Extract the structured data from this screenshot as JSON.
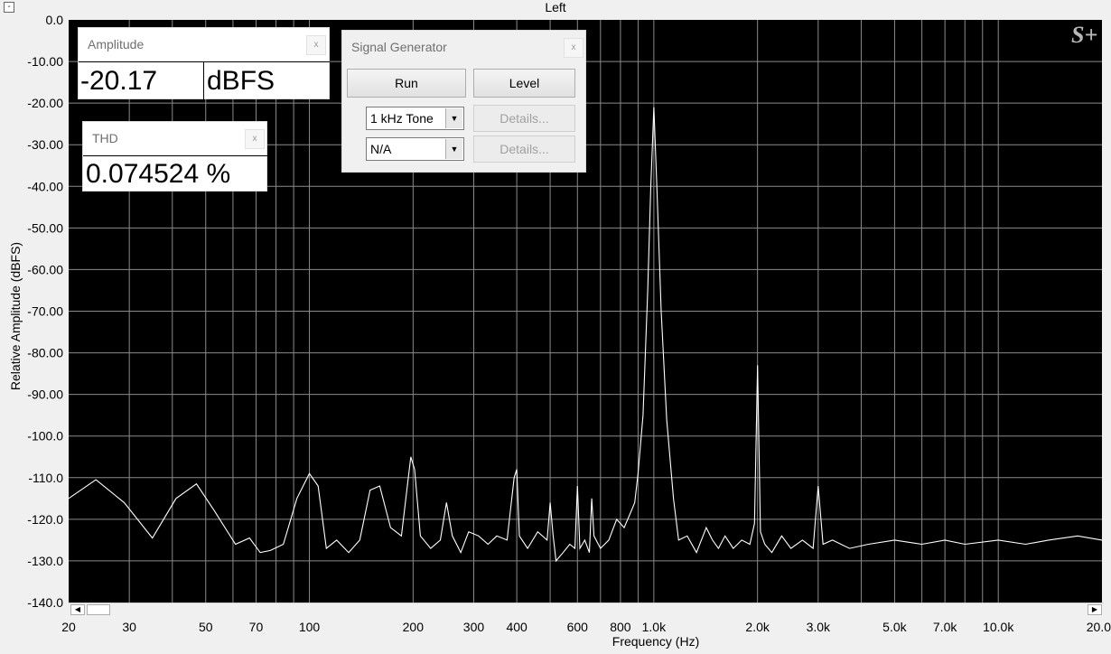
{
  "window": {
    "title": "Left",
    "collapse_glyph": "-"
  },
  "logo": {
    "text": "S+"
  },
  "amplitude": {
    "title": "Amplitude",
    "value": "-20.17",
    "unit": "dBFS",
    "close": "x"
  },
  "thd": {
    "title": "THD",
    "value": "0.074524 %",
    "close": "x"
  },
  "signal_generator": {
    "title": "Signal Generator",
    "close": "x",
    "run_label": "Run",
    "level_label": "Level",
    "select1": "1 kHz Tone",
    "select2": "N/A",
    "details_label": "Details..."
  },
  "chart_data": {
    "type": "line",
    "title": "Left",
    "xlabel": "Frequency (Hz)",
    "ylabel": "Relative Amplitude (dBFS)",
    "xscale": "log",
    "xlim": [
      20,
      20000
    ],
    "ylim": [
      -140,
      0
    ],
    "grid": true,
    "background": "#000000",
    "line_color": "#ffffff",
    "grid_color": "#8a8a8a",
    "x_ticks": [
      20,
      30,
      50,
      70,
      100,
      200,
      300,
      400,
      600,
      800,
      1000,
      2000,
      3000,
      5000,
      7000,
      10000,
      20000
    ],
    "x_tick_labels": [
      "20",
      "30",
      "50",
      "70",
      "100",
      "200",
      "300",
      "400",
      "600",
      "800",
      "1.0k",
      "2.0k",
      "3.0k",
      "5.0k",
      "7.0k",
      "10.0k",
      "20.0"
    ],
    "y_ticks": [
      0,
      -10,
      -20,
      -30,
      -40,
      -50,
      -60,
      -70,
      -80,
      -90,
      -100,
      -110,
      -120,
      -130,
      -140
    ],
    "y_tick_labels": [
      "0.0",
      "-10.00",
      "-20.00",
      "-30.00",
      "-40.00",
      "-50.00",
      "-60.00",
      "-70.00",
      "-80.00",
      "-90.00",
      "-100.0",
      "-110.0",
      "-120.0",
      "-130.0",
      "-140.0"
    ],
    "series": [
      {
        "x": [
          20,
          24,
          29,
          35,
          41,
          47,
          53,
          61,
          67,
          72,
          77,
          84,
          92,
          100,
          106,
          112,
          120,
          130,
          140,
          150,
          160,
          172,
          185,
          197,
          202,
          210,
          225,
          240,
          250,
          260,
          275,
          290,
          310,
          330,
          350,
          375,
          393,
          400,
          407,
          430,
          460,
          490,
          500,
          510,
          520,
          545,
          570,
          590,
          600,
          610,
          630,
          650,
          660,
          670,
          700,
          740,
          780,
          820,
          860,
          880,
          900,
          930,
          960,
          980,
          1000,
          1020,
          1050,
          1090,
          1140,
          1180,
          1250,
          1330,
          1420,
          1480,
          1540,
          1610,
          1700,
          1800,
          1900,
          1960,
          2000,
          2040,
          2100,
          2200,
          2350,
          2500,
          2700,
          2900,
          3000,
          3100,
          3300,
          3700,
          4200,
          5000,
          6000,
          7000,
          8000,
          10000,
          12000,
          14000,
          17000,
          20000
        ],
        "y": [
          -115,
          -110.5,
          -116,
          -124.5,
          -115,
          -111.5,
          -118,
          -126,
          -124.5,
          -128,
          -127.5,
          -126,
          -115,
          -109,
          -112,
          -127,
          -125,
          -128,
          -125,
          -113,
          -112,
          -122,
          -124,
          -105,
          -108,
          -124,
          -127,
          -125,
          -116,
          -124,
          -128,
          -123,
          -124,
          -126,
          -124,
          -125,
          -110,
          -108,
          -124,
          -127,
          -123,
          -125,
          -116,
          -124,
          -130,
          -128,
          -126,
          -127,
          -112,
          -127,
          -125,
          -128,
          -115,
          -124,
          -127,
          -125,
          -120,
          -122,
          -118,
          -116,
          -109,
          -95,
          -65,
          -40,
          -21,
          -40,
          -70,
          -96,
          -115,
          -125,
          -124,
          -128,
          -122,
          -125,
          -127,
          -124,
          -127,
          -125,
          -126,
          -121,
          -83,
          -123,
          -126,
          -128,
          -124,
          -127,
          -125,
          -127,
          -112,
          -126,
          -125,
          -127,
          -126,
          -125,
          -126,
          -125,
          -126,
          -125,
          -126,
          -125,
          -124,
          -125
        ]
      }
    ]
  }
}
